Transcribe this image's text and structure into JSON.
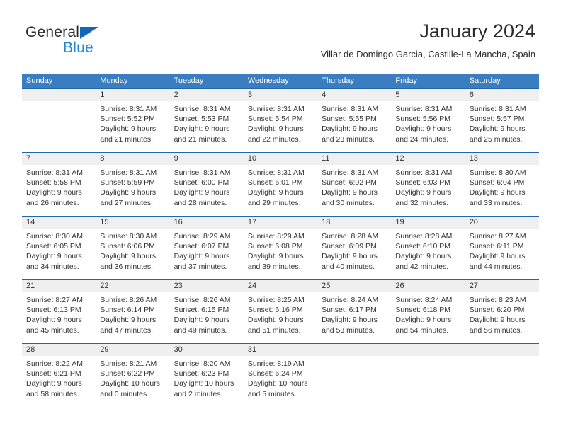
{
  "brand": {
    "name_top": "General",
    "name_bottom": "Blue"
  },
  "header": {
    "title": "January 2024",
    "subtitle": "Villar de Domingo Garcia, Castille-La Mancha, Spain"
  },
  "colors": {
    "header_blue": "#3a7dc0",
    "row_border_blue": "#1f66ad",
    "daynum_band": "#efefef",
    "logo_blue": "#2586d8",
    "logo_triangle": "#1565b8"
  },
  "calendar": {
    "weekdays": [
      "Sunday",
      "Monday",
      "Tuesday",
      "Wednesday",
      "Thursday",
      "Friday",
      "Saturday"
    ],
    "weeks": [
      {
        "days": [
          {
            "num": "",
            "sunrise": "",
            "sunset": "",
            "daylight1": "",
            "daylight2": "",
            "empty": true
          },
          {
            "num": "1",
            "sunrise": "Sunrise: 8:31 AM",
            "sunset": "Sunset: 5:52 PM",
            "daylight1": "Daylight: 9 hours",
            "daylight2": "and 21 minutes."
          },
          {
            "num": "2",
            "sunrise": "Sunrise: 8:31 AM",
            "sunset": "Sunset: 5:53 PM",
            "daylight1": "Daylight: 9 hours",
            "daylight2": "and 21 minutes."
          },
          {
            "num": "3",
            "sunrise": "Sunrise: 8:31 AM",
            "sunset": "Sunset: 5:54 PM",
            "daylight1": "Daylight: 9 hours",
            "daylight2": "and 22 minutes."
          },
          {
            "num": "4",
            "sunrise": "Sunrise: 8:31 AM",
            "sunset": "Sunset: 5:55 PM",
            "daylight1": "Daylight: 9 hours",
            "daylight2": "and 23 minutes."
          },
          {
            "num": "5",
            "sunrise": "Sunrise: 8:31 AM",
            "sunset": "Sunset: 5:56 PM",
            "daylight1": "Daylight: 9 hours",
            "daylight2": "and 24 minutes."
          },
          {
            "num": "6",
            "sunrise": "Sunrise: 8:31 AM",
            "sunset": "Sunset: 5:57 PM",
            "daylight1": "Daylight: 9 hours",
            "daylight2": "and 25 minutes."
          }
        ]
      },
      {
        "days": [
          {
            "num": "7",
            "sunrise": "Sunrise: 8:31 AM",
            "sunset": "Sunset: 5:58 PM",
            "daylight1": "Daylight: 9 hours",
            "daylight2": "and 26 minutes."
          },
          {
            "num": "8",
            "sunrise": "Sunrise: 8:31 AM",
            "sunset": "Sunset: 5:59 PM",
            "daylight1": "Daylight: 9 hours",
            "daylight2": "and 27 minutes."
          },
          {
            "num": "9",
            "sunrise": "Sunrise: 8:31 AM",
            "sunset": "Sunset: 6:00 PM",
            "daylight1": "Daylight: 9 hours",
            "daylight2": "and 28 minutes."
          },
          {
            "num": "10",
            "sunrise": "Sunrise: 8:31 AM",
            "sunset": "Sunset: 6:01 PM",
            "daylight1": "Daylight: 9 hours",
            "daylight2": "and 29 minutes."
          },
          {
            "num": "11",
            "sunrise": "Sunrise: 8:31 AM",
            "sunset": "Sunset: 6:02 PM",
            "daylight1": "Daylight: 9 hours",
            "daylight2": "and 30 minutes."
          },
          {
            "num": "12",
            "sunrise": "Sunrise: 8:31 AM",
            "sunset": "Sunset: 6:03 PM",
            "daylight1": "Daylight: 9 hours",
            "daylight2": "and 32 minutes."
          },
          {
            "num": "13",
            "sunrise": "Sunrise: 8:30 AM",
            "sunset": "Sunset: 6:04 PM",
            "daylight1": "Daylight: 9 hours",
            "daylight2": "and 33 minutes."
          }
        ]
      },
      {
        "days": [
          {
            "num": "14",
            "sunrise": "Sunrise: 8:30 AM",
            "sunset": "Sunset: 6:05 PM",
            "daylight1": "Daylight: 9 hours",
            "daylight2": "and 34 minutes."
          },
          {
            "num": "15",
            "sunrise": "Sunrise: 8:30 AM",
            "sunset": "Sunset: 6:06 PM",
            "daylight1": "Daylight: 9 hours",
            "daylight2": "and 36 minutes."
          },
          {
            "num": "16",
            "sunrise": "Sunrise: 8:29 AM",
            "sunset": "Sunset: 6:07 PM",
            "daylight1": "Daylight: 9 hours",
            "daylight2": "and 37 minutes."
          },
          {
            "num": "17",
            "sunrise": "Sunrise: 8:29 AM",
            "sunset": "Sunset: 6:08 PM",
            "daylight1": "Daylight: 9 hours",
            "daylight2": "and 39 minutes."
          },
          {
            "num": "18",
            "sunrise": "Sunrise: 8:28 AM",
            "sunset": "Sunset: 6:09 PM",
            "daylight1": "Daylight: 9 hours",
            "daylight2": "and 40 minutes."
          },
          {
            "num": "19",
            "sunrise": "Sunrise: 8:28 AM",
            "sunset": "Sunset: 6:10 PM",
            "daylight1": "Daylight: 9 hours",
            "daylight2": "and 42 minutes."
          },
          {
            "num": "20",
            "sunrise": "Sunrise: 8:27 AM",
            "sunset": "Sunset: 6:11 PM",
            "daylight1": "Daylight: 9 hours",
            "daylight2": "and 44 minutes."
          }
        ]
      },
      {
        "days": [
          {
            "num": "21",
            "sunrise": "Sunrise: 8:27 AM",
            "sunset": "Sunset: 6:13 PM",
            "daylight1": "Daylight: 9 hours",
            "daylight2": "and 45 minutes."
          },
          {
            "num": "22",
            "sunrise": "Sunrise: 8:26 AM",
            "sunset": "Sunset: 6:14 PM",
            "daylight1": "Daylight: 9 hours",
            "daylight2": "and 47 minutes."
          },
          {
            "num": "23",
            "sunrise": "Sunrise: 8:26 AM",
            "sunset": "Sunset: 6:15 PM",
            "daylight1": "Daylight: 9 hours",
            "daylight2": "and 49 minutes."
          },
          {
            "num": "24",
            "sunrise": "Sunrise: 8:25 AM",
            "sunset": "Sunset: 6:16 PM",
            "daylight1": "Daylight: 9 hours",
            "daylight2": "and 51 minutes."
          },
          {
            "num": "25",
            "sunrise": "Sunrise: 8:24 AM",
            "sunset": "Sunset: 6:17 PM",
            "daylight1": "Daylight: 9 hours",
            "daylight2": "and 53 minutes."
          },
          {
            "num": "26",
            "sunrise": "Sunrise: 8:24 AM",
            "sunset": "Sunset: 6:18 PM",
            "daylight1": "Daylight: 9 hours",
            "daylight2": "and 54 minutes."
          },
          {
            "num": "27",
            "sunrise": "Sunrise: 8:23 AM",
            "sunset": "Sunset: 6:20 PM",
            "daylight1": "Daylight: 9 hours",
            "daylight2": "and 56 minutes."
          }
        ]
      },
      {
        "days": [
          {
            "num": "28",
            "sunrise": "Sunrise: 8:22 AM",
            "sunset": "Sunset: 6:21 PM",
            "daylight1": "Daylight: 9 hours",
            "daylight2": "and 58 minutes."
          },
          {
            "num": "29",
            "sunrise": "Sunrise: 8:21 AM",
            "sunset": "Sunset: 6:22 PM",
            "daylight1": "Daylight: 10 hours",
            "daylight2": "and 0 minutes."
          },
          {
            "num": "30",
            "sunrise": "Sunrise: 8:20 AM",
            "sunset": "Sunset: 6:23 PM",
            "daylight1": "Daylight: 10 hours",
            "daylight2": "and 2 minutes."
          },
          {
            "num": "31",
            "sunrise": "Sunrise: 8:19 AM",
            "sunset": "Sunset: 6:24 PM",
            "daylight1": "Daylight: 10 hours",
            "daylight2": "and 5 minutes."
          },
          {
            "num": "",
            "sunrise": "",
            "sunset": "",
            "daylight1": "",
            "daylight2": "",
            "empty": true
          },
          {
            "num": "",
            "sunrise": "",
            "sunset": "",
            "daylight1": "",
            "daylight2": "",
            "empty": true
          },
          {
            "num": "",
            "sunrise": "",
            "sunset": "",
            "daylight1": "",
            "daylight2": "",
            "empty": true
          }
        ]
      }
    ]
  }
}
